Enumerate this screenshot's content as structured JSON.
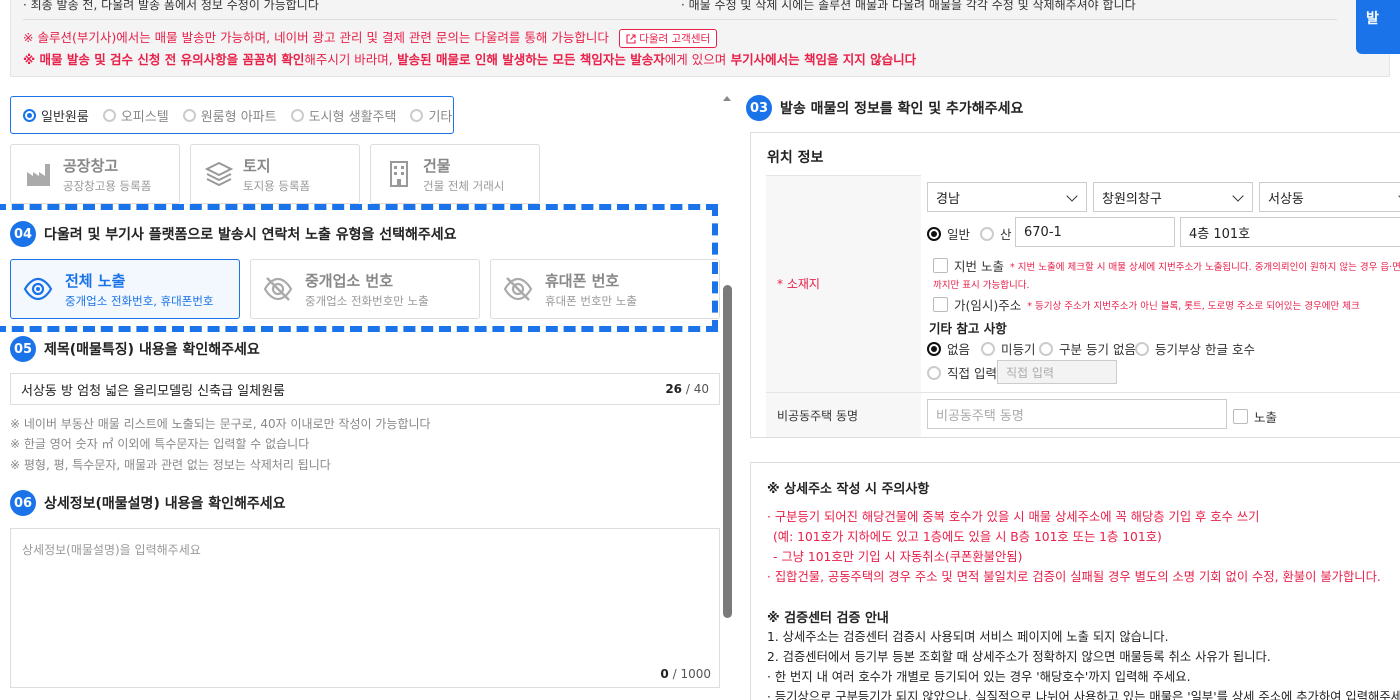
{
  "notice": {
    "line1_left": "· 최종 발송 전, 다울려 발송 폼에서 정보 수정이 가능합니다",
    "line1_right": "· 매물 수정 및 삭제 시에는 솔루션 매물과 다울려 매물을 각각 수정 및 삭제해주셔야 합니다",
    "line2": "※ 솔루션(부기사)에서는 매물 발송만 가능하며, 네이버 광고 관리 및 결제 관련 문의는 다울려를 통해 가능합니다",
    "cs_button": "다울려 고객센터",
    "line3_a": "※ 매물 발송 및 검수 신청 전 유의사항을 꼼꼼히 확인",
    "line3_b": "해주시기 바라며,",
    "line3_c": " 발송된 매물로 인해 발생하는 모든 책임자는 발송자",
    "line3_d": "에게 있으며",
    "line3_e": " 부기사에서는 책임을 지지 않습니다",
    "corner_text": "발"
  },
  "property_types": [
    {
      "label": "일반원룸",
      "selected": true
    },
    {
      "label": "오피스텔",
      "selected": false
    },
    {
      "label": "원룸형 아파트",
      "selected": false
    },
    {
      "label": "도시형 생활주택",
      "selected": false
    },
    {
      "label": "기타",
      "selected": false
    }
  ],
  "type_cards": [
    {
      "title": "공장창고",
      "sub": "공장창고용 등록폼",
      "icon": "factory-icon"
    },
    {
      "title": "토지",
      "sub": "토지용 등록폼",
      "icon": "layers-icon"
    },
    {
      "title": "건물",
      "sub": "건물 전체 거래시",
      "icon": "building-icon"
    }
  ],
  "section04": {
    "num": "04",
    "title": "다울려 및 부기사 플랫폼으로 발송시 연락처 노출 유형을 선택해주세요",
    "options": [
      {
        "title": "전체 노출",
        "sub": "중개업소 전화번호, 휴대폰번호",
        "selected": true
      },
      {
        "title": "중개업소 번호",
        "sub": "중개업소 전화번호만 노출",
        "selected": false
      },
      {
        "title": "휴대폰 번호",
        "sub": "휴대폰 번호만 노출",
        "selected": false
      }
    ]
  },
  "section05": {
    "num": "05",
    "title": "제목(매물특징) 내용을 확인해주세요",
    "value": "서상동 방 엄청 넓은 올리모델링 신축급 일체원룸",
    "count": "26",
    "max": "/ 40",
    "hints": [
      "※ 네이버 부동산 매물 리스트에 노출되는 문구로, 40자 이내로만 작성이 가능합니다",
      "※ 한글 영어 숫자 ㎡ 이외에 특수문자는 입력할 수 없습니다",
      "※ 평형, 평, 특수문자, 매물과 관련 없는 정보는 삭제처리 됩니다"
    ]
  },
  "section06": {
    "num": "06",
    "title": "상세정보(매물설명) 내용을 확인해주세요",
    "placeholder": "상세정보(매물설명)을 입력해주세요",
    "count": "0",
    "max": "/ 1000"
  },
  "section03": {
    "num": "03",
    "title": "발송 매물의 정보를 확인 및 추가해주세요"
  },
  "location": {
    "title": "위치 정보",
    "address_label": "* 소재지",
    "sido": "경남",
    "sigungu": "창원의창구",
    "dong": "서상동",
    "lot_type_general": "일반",
    "lot_type_mountain": "산",
    "lot_number": "670-1",
    "detail": "4층 101호",
    "jibun_expose_label": "지번 노출",
    "jibun_note_1": "* 지번 노출에 체크할 시 매물 상세에 지번주소가 노출됩니다. 중개의뢰인이 원하지 않는 경우 읍·면·동",
    "jibun_note_2": "까지만 표시 가능합니다.",
    "temp_addr_label": "가(임시)주소",
    "temp_addr_note": "* 등기상 주소가 지번주소가 아닌 블록, 롯트, 도로명 주소로 되어있는 경우에만 체크",
    "etc_title": "기타 참고 사항",
    "etc_options": [
      {
        "label": "없음",
        "selected": true
      },
      {
        "label": "미등기",
        "selected": false
      },
      {
        "label": "구분 등기 없음",
        "selected": false
      },
      {
        "label": "등기부상 한글 호수",
        "selected": false
      }
    ],
    "direct_label": "직접 입력",
    "direct_placeholder": "직접 입력",
    "private_label": "비공동주택 동명",
    "private_placeholder": "비공동주택 동명",
    "expose_label": "노출"
  },
  "warnings": {
    "title1": "※ 상세주소 작성 시 주의사항",
    "red_lines": [
      "· 구분등기 되어진 해당건물에 중복 호수가 있을 시 매물 상세주소에 꼭 해당층 기입 후 호수 쓰기",
      "  (예: 101호가 지하에도 있고 1층에도 있을 시 B층 101호 또는 1층 101호)",
      "  - 그냥 101호만 기입 시 자동취소(쿠폰환불안됨)",
      "· 집합건물, 공동주택의 경우 주소 및 면적 불일치로 검증이 실패될 경우 별도의 소명 기회 없이 수정, 환불이 불가합니다."
    ],
    "title2": "※ 검증센터 검증 안내",
    "lines": [
      "1. 상세주소는 검증센터 검증시 사용되며 서비스 페이지에 노출 되지 않습니다.",
      "2. 검증센터에서 등기부 등본 조회할 때 상세주소가 정확하지 않으면 매물등록 취소 사유가 됩니다.",
      " · 한 번지 내 여러 호수가 개별로 등기되어 있는 경우 '해당호수'까지 입력해 주세요.",
      " · 등기상으로 구분등기가 되지 않았으나, 실질적으로 나뉘어 사용하고 있는 매물은 '일부'를 상세 주소에 추가하여 입력해주세요."
    ]
  },
  "colors": {
    "accent": "#1a73e8",
    "red": "#e8204a"
  }
}
